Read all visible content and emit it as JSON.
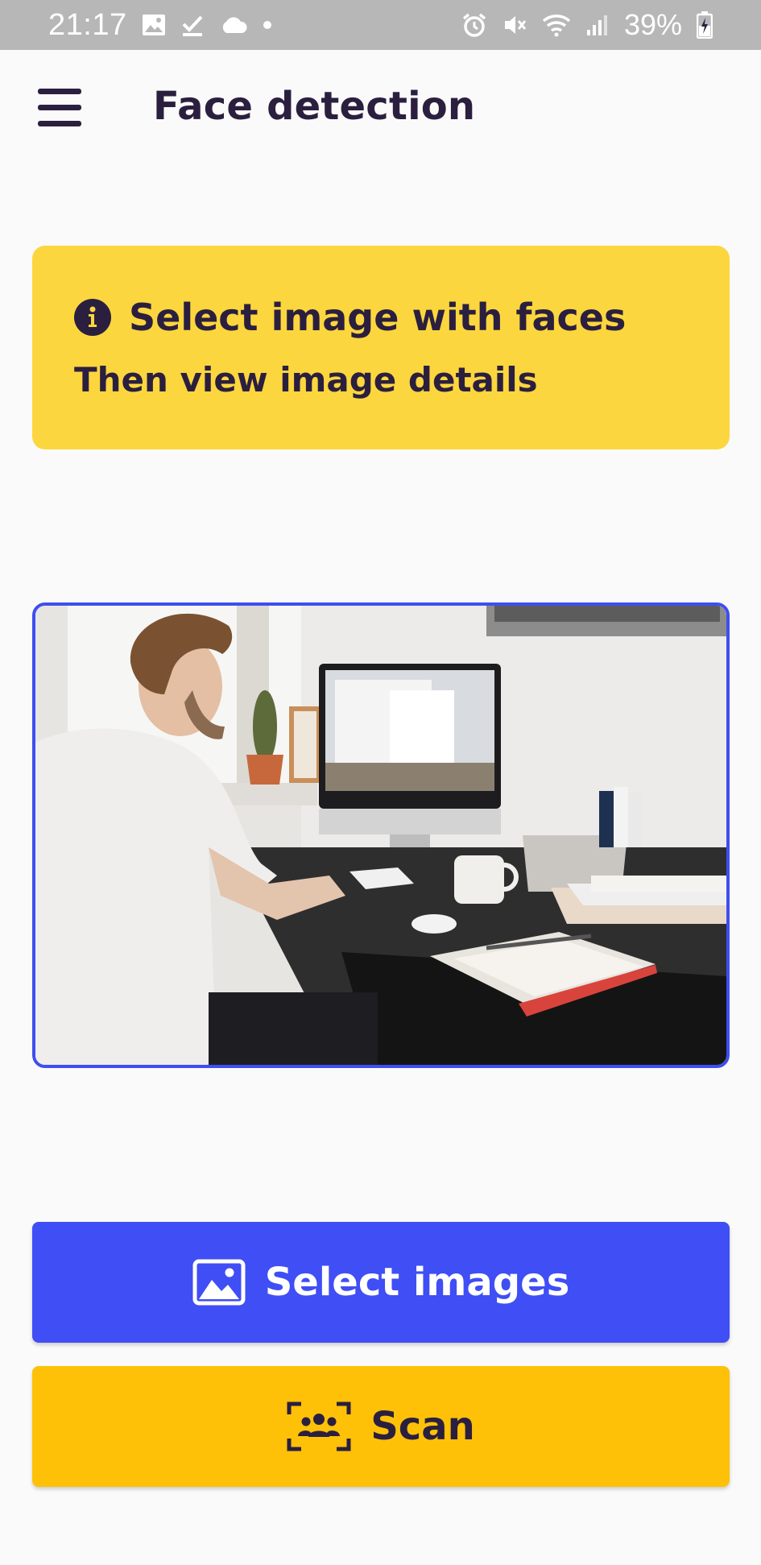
{
  "status_bar": {
    "time": "21:17",
    "battery_percent": "39%",
    "left_icons": [
      "gallery-icon",
      "check-download-icon",
      "cloud-icon",
      "dot-icon"
    ],
    "right_icons": [
      "alarm-icon",
      "mute-icon",
      "wifi-icon",
      "signal-icon",
      "battery-charging-icon"
    ]
  },
  "app_bar": {
    "menu_icon": "hamburger-menu-icon",
    "title": "Face detection"
  },
  "info_banner": {
    "icon": "info-icon",
    "title": "Select image with faces",
    "subtitle": "Then view image details",
    "background": "#fcd63e"
  },
  "preview": {
    "border_color": "#3f4ef0"
  },
  "buttons": {
    "select_images": {
      "label": "Select images",
      "icon": "image-icon",
      "color": "#3f4ef5"
    },
    "scan": {
      "label": "Scan",
      "icon": "face-scan-icon",
      "color": "#fec107"
    }
  }
}
